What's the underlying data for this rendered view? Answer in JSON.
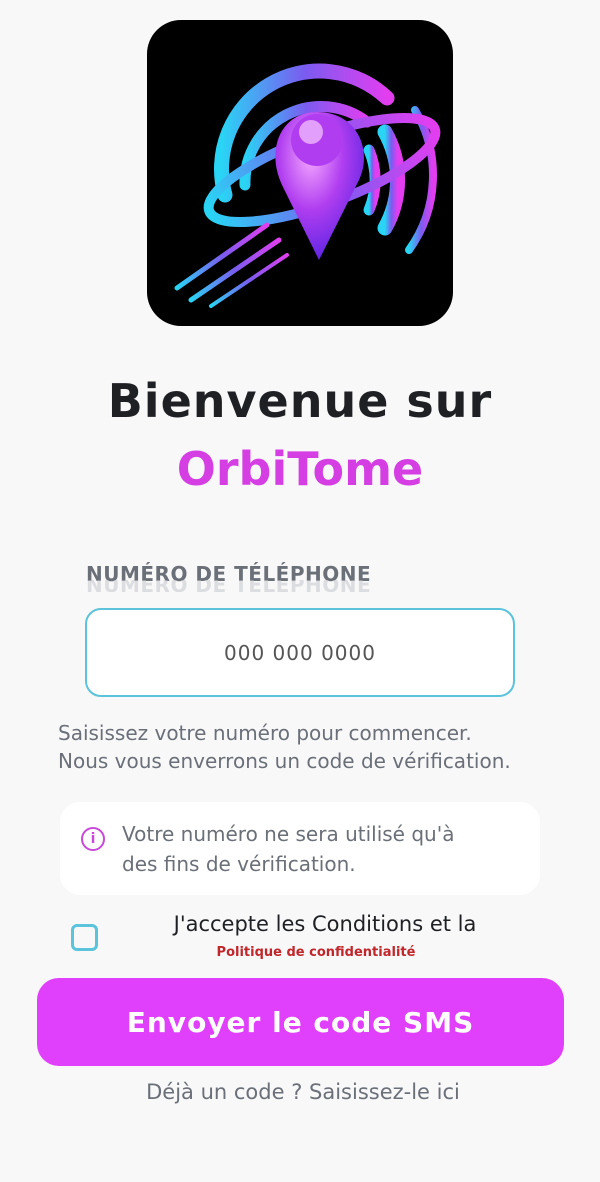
{
  "logo": {
    "name": "orbitome-logo-icon"
  },
  "welcome": {
    "title": "Bienvenue sur",
    "brand": "OrbiTome"
  },
  "phone": {
    "label": "NUMÉRO DE TÉLÉPHONE",
    "placeholder": "000 000 0000",
    "value": ""
  },
  "hint": {
    "line1": "Saisissez votre numéro pour commencer.",
    "line2": "Nous vous enverrons un code de vérification."
  },
  "info": {
    "icon": "info-icon",
    "line1": "Votre numéro ne sera utilisé qu'à",
    "line2": "des fins de vérification."
  },
  "terms": {
    "checked": false,
    "text": "J'accepte les Conditions et la",
    "link": "Politique de confidentialité"
  },
  "actions": {
    "send_sms": "Envoyer le code SMS",
    "have_code": "Déjà un code ? Saisissez-le ici"
  },
  "colors": {
    "brand": "#d43ee3",
    "button": "#e040fb",
    "input_border": "#5bc3da",
    "link": "#c0262a"
  }
}
